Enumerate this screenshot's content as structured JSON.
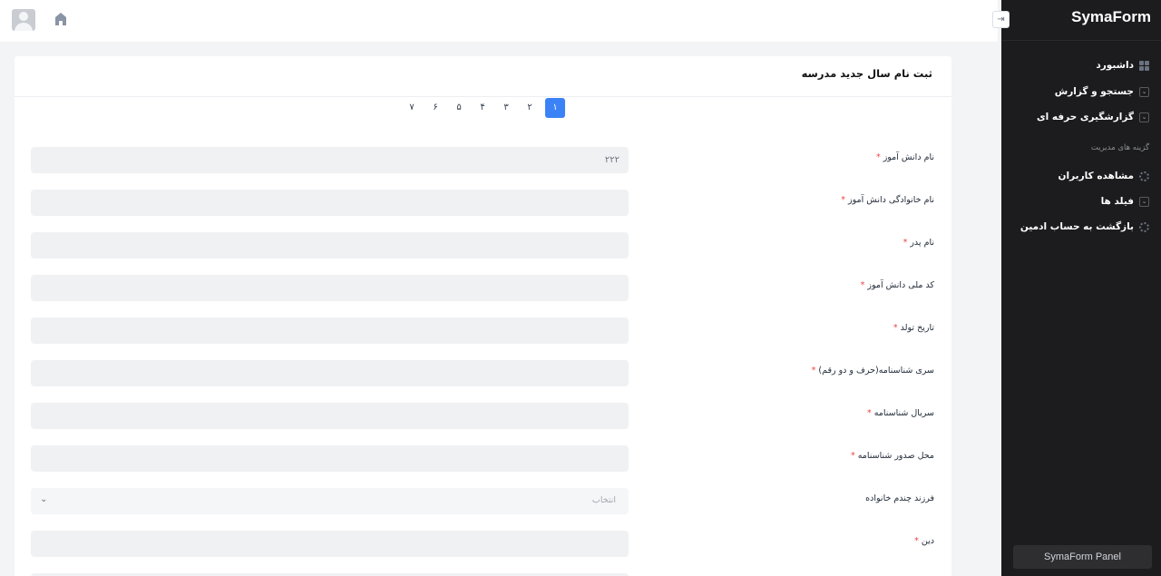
{
  "brand": {
    "name": "SymaForm",
    "panel_button": "SymaForm Panel"
  },
  "topbar": {
    "avatar_icon": "user-avatar-icon",
    "home_icon": "home-icon",
    "collapse_icon": "collapse-sidebar-icon",
    "collapse_glyph": "⇥"
  },
  "sidebar": {
    "items": [
      {
        "label": "داشبورد",
        "icon": "grid-icon"
      },
      {
        "label": "جستجو و گزارش",
        "icon": "chevron-down-icon"
      },
      {
        "label": "گزارشگیری حرفه ای",
        "icon": "chevron-down-icon"
      }
    ],
    "section_label": "گزینه های مدیریت",
    "admin_items": [
      {
        "label": "مشاهده کاربران",
        "icon": "gear-icon"
      },
      {
        "label": "فیلد ها",
        "icon": "chevron-down-icon"
      },
      {
        "label": "بازگشت به حساب ادمین",
        "icon": "gear-icon"
      }
    ]
  },
  "form": {
    "title": "ثبت نام سال جدید مدرسه",
    "steps": [
      "۱",
      "۲",
      "۳",
      "۴",
      "۵",
      "۶",
      "۷"
    ],
    "active_step": "۱",
    "fields": [
      {
        "label": "نام دانش آموز",
        "required": true,
        "value": "۲۲۲"
      },
      {
        "label": "نام خانوادگی دانش آموز",
        "required": true,
        "value": ""
      },
      {
        "label": "نام پدر",
        "required": true,
        "value": ""
      },
      {
        "label": "کد ملی دانش آموز",
        "required": true,
        "value": ""
      },
      {
        "label": "تاریخ تولد",
        "required": true,
        "value": ""
      },
      {
        "label": "سری شناسنامه(حرف و دو رقم)",
        "required": true,
        "value": ""
      },
      {
        "label": "سریال شناسنامه",
        "required": true,
        "value": ""
      },
      {
        "label": "محل صدور شناسنامه",
        "required": true,
        "value": ""
      },
      {
        "label": "فرزند چندم خانواده",
        "required": false,
        "type": "select",
        "placeholder": "انتخاب"
      },
      {
        "label": "دین",
        "required": true,
        "value": ""
      }
    ],
    "required_mark": "*"
  }
}
